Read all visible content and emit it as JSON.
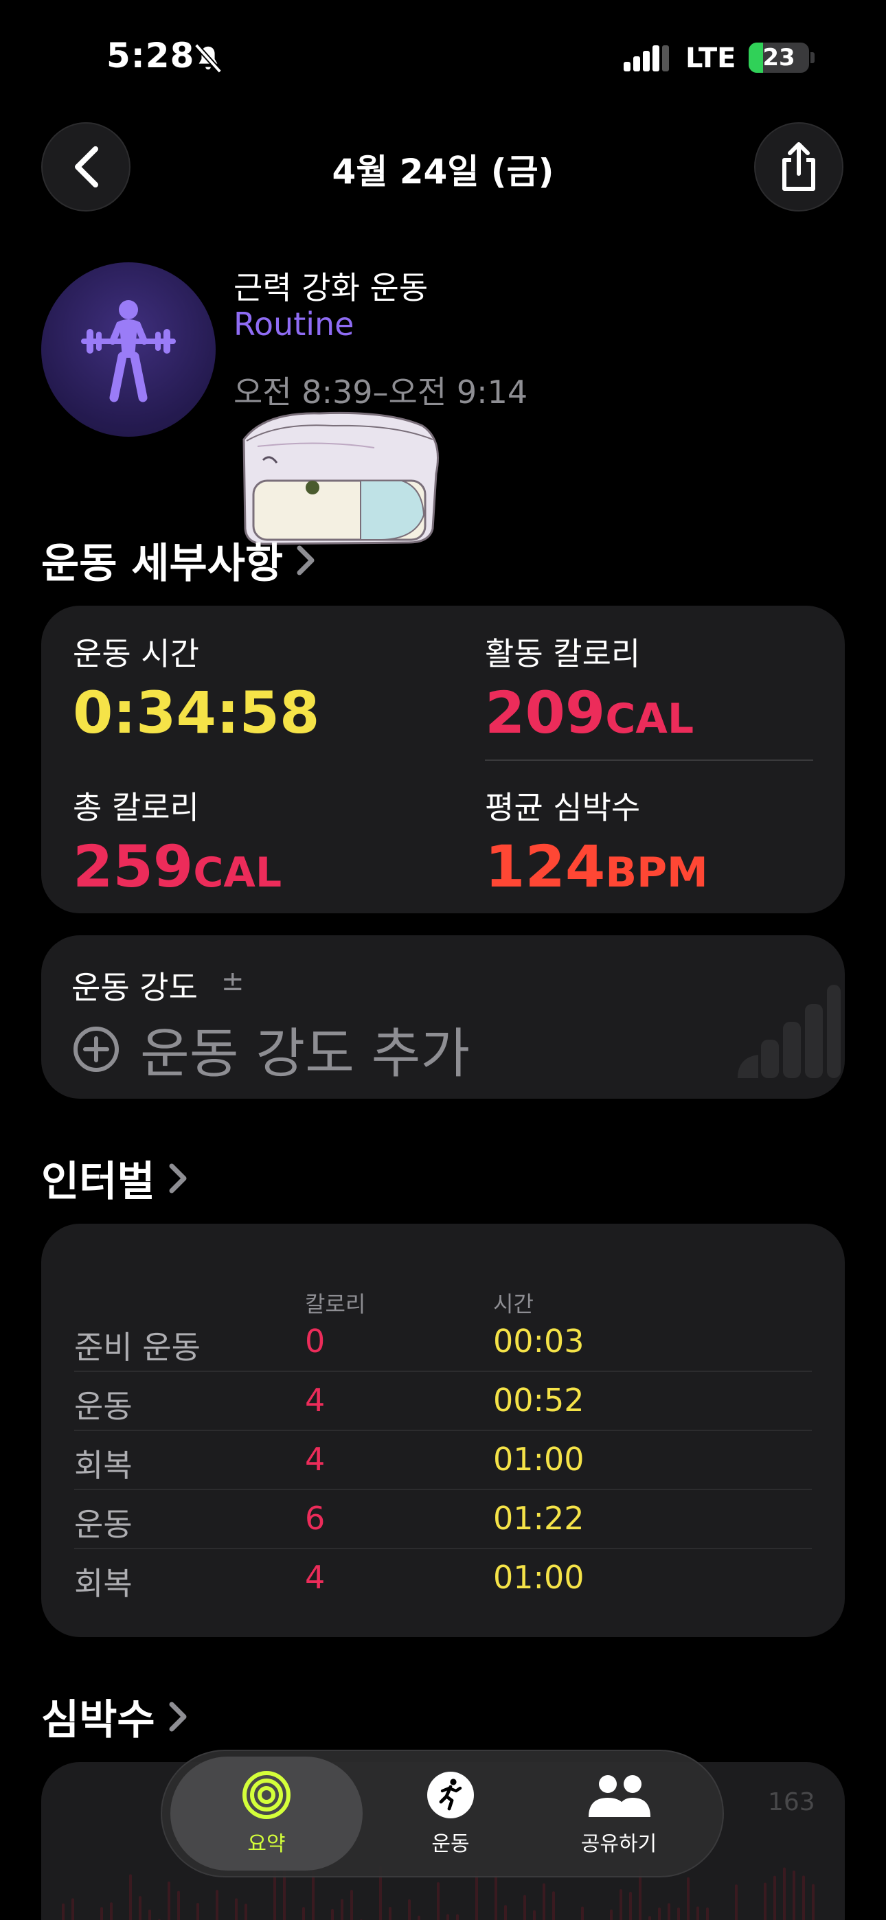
{
  "status_bar": {
    "time": "5:28",
    "network": "LTE",
    "battery": "23"
  },
  "nav": {
    "title": "4월 24일 (금)"
  },
  "workout": {
    "name": "근력 강화 운동",
    "subtitle": "Routine",
    "time_range": "오전 8:39–오전 9:14"
  },
  "sections": {
    "details": "운동 세부사항",
    "intervals": "인터벌",
    "heart_rate": "심박수"
  },
  "metrics": {
    "duration": {
      "label": "운동 시간",
      "value": "0:34:58",
      "color": "#f5e348"
    },
    "active_cal": {
      "label": "활동 칼로리",
      "value": "209",
      "unit": "CAL",
      "color": "#ec2c5a"
    },
    "total_cal": {
      "label": "총 칼로리",
      "value": "259",
      "unit": "CAL",
      "color": "#ec2c5a"
    },
    "avg_hr": {
      "label": "평균 심박수",
      "value": "124",
      "unit": "BPM",
      "color": "#ff4734"
    }
  },
  "effort": {
    "label": "운동 강도",
    "pm": "±",
    "add_label": "운동 강도 추가"
  },
  "intervals": {
    "col_calories": "칼로리",
    "col_time": "시간",
    "rows": [
      {
        "name": "준비 운동",
        "cal": "0",
        "time": "00:03"
      },
      {
        "name": "운동",
        "cal": "4",
        "time": "00:52"
      },
      {
        "name": "회복",
        "cal": "4",
        "time": "01:00"
      },
      {
        "name": "운동",
        "cal": "6",
        "time": "01:22"
      },
      {
        "name": "회복",
        "cal": "4",
        "time": "01:00"
      }
    ]
  },
  "heart_rate": {
    "max_label": "163"
  },
  "tabbar": {
    "summary": "요약",
    "workout": "운동",
    "sharing": "공유하기",
    "active_color": "#d4ff3a"
  }
}
